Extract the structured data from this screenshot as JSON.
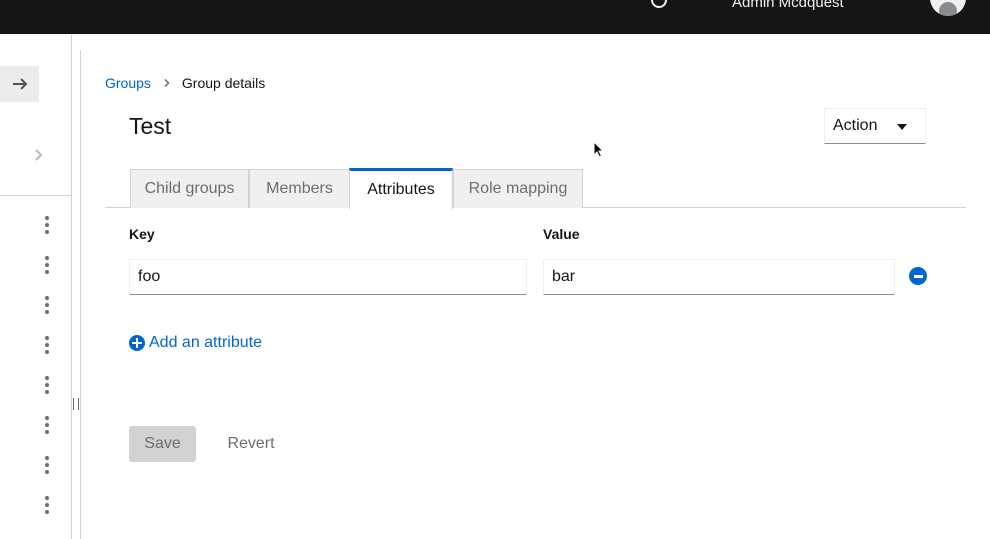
{
  "masthead": {
    "user_name": "Admin Mcdquest"
  },
  "breadcrumb": {
    "root": "Groups",
    "current": "Group details"
  },
  "page": {
    "title": "Test",
    "action_label": "Action"
  },
  "tabs": [
    {
      "label": "Child groups",
      "active": false
    },
    {
      "label": "Members",
      "active": false
    },
    {
      "label": "Attributes",
      "active": true
    },
    {
      "label": "Role mapping",
      "active": false
    }
  ],
  "attributes": {
    "key_header": "Key",
    "value_header": "Value",
    "rows": [
      {
        "key": "foo",
        "value": "bar"
      }
    ],
    "add_label": "Add an attribute"
  },
  "form": {
    "save_label": "Save",
    "revert_label": "Revert"
  },
  "colors": {
    "link": "#0066cc",
    "masthead": "#151515",
    "active_tab_border": "#0066cc"
  }
}
